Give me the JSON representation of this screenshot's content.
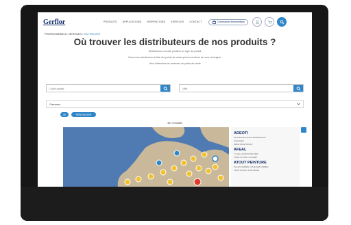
{
  "header": {
    "logo": "Gerflor",
    "nav": [
      "PRODUITS",
      "APPLICATIONS",
      "INSPIRATIONS",
      "SERVICES",
      "CONTACT"
    ],
    "order_label": "Commande d'échantillons",
    "icon_labels": [
      "MON COMPTE",
      "PANIER",
      "RECHERCHE"
    ]
  },
  "breadcrumb": {
    "path": "PROFESSIONNELS > SERVICES >",
    "current": "OÙ TROUVER"
  },
  "page": {
    "title": "Où trouver les distributeurs de nos produits ?",
    "description": [
      "Sélectionnez un code postal et un type de produit",
      "Nous vous dévoilerons la liste des points de vente qui sont à même de vous renseigner",
      "Vous obtiendrez les adresses de points de vente"
    ]
  },
  "search": {
    "left_placeholder": "Code postal",
    "right_placeholder": "Ville"
  },
  "filter": {
    "label": "Gammes"
  },
  "chips": [
    "OK",
    "RÉINITIALISER"
  ],
  "results_label": "361 résultats",
  "list": [
    {
      "name": "ADEOTI",
      "lines": [
        "69 RUE FRANCOIS BONNEVILLE",
        "3 ECOLES",
        "95560 MONTSOULT"
      ]
    },
    {
      "name": "AFEAL",
      "lines": [
        "7 CHE LA CROIX DE FER",
        "27480 LYONS LA FORET"
      ]
    },
    {
      "name": "ATOUT PEINTURE",
      "lines": [
        "ZA LES ORMES 4 RUE DES ORMES",
        "78710 ROSNY-SUR-SEINE"
      ]
    }
  ],
  "colors": {
    "accent": "#2f86c8",
    "brand": "#0e2a66",
    "map_sea": "#4f7bb2",
    "map_land": "#c9b99a",
    "marker_cluster": "#f2c12e",
    "marker_selected": "#e23c2a"
  }
}
